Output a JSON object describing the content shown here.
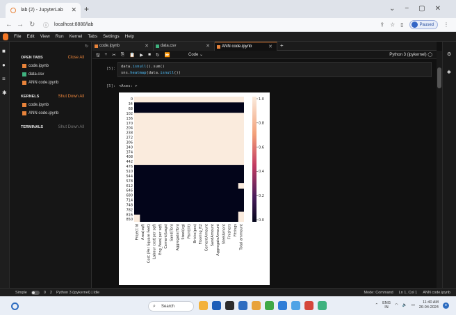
{
  "browser": {
    "tab_title": "lab (2) - JupyterLab",
    "url": "localhost:8888/lab",
    "profile": "Paused"
  },
  "menubar": [
    "File",
    "Edit",
    "View",
    "Run",
    "Kernel",
    "Tabs",
    "Settings",
    "Help"
  ],
  "sidebar": {
    "open_tabs_title": "OPEN TABS",
    "close_all": "Close All",
    "open_tabs": [
      "code.ipynb",
      "data.csv",
      "ANN code.ipynb"
    ],
    "kernels_title": "KERNELS",
    "shut_down_all": "Shut Down All",
    "kernels": [
      "code.ipynb",
      "ANN code.ipynb"
    ],
    "terminals_title": "TERMINALS",
    "terminals_shut_down": "Shut Down All"
  },
  "doc_tabs": [
    "code.ipynb",
    "data.csv",
    "ANN code.ipynb"
  ],
  "toolbar": {
    "cell_type": "Code",
    "kernel": "Python 3 (ipykernel)"
  },
  "cell": {
    "in_prompt": "[5]:",
    "line1_a": "data.",
    "line1_b": "isnull",
    "line1_c": "().sum()",
    "line2_a": "sns.",
    "line2_b": "heatmap",
    "line2_c": "(data.",
    "line2_d": "isnull",
    "line2_e": "())",
    "out_prompt": "[5]:",
    "out_text": "<Axes: >"
  },
  "chart_data": {
    "type": "heatmap",
    "title": "",
    "y_ticks": [
      "0",
      "34",
      "68",
      "102",
      "136",
      "170",
      "204",
      "238",
      "272",
      "306",
      "340",
      "374",
      "408",
      "442",
      "476",
      "510",
      "544",
      "578",
      "612",
      "646",
      "680",
      "714",
      "748",
      "782",
      "816",
      "850"
    ],
    "x_ticks": [
      "Project Id",
      "Area(sqf)",
      "Cost (Per Square Feet)",
      "Labour cost(per sqf)",
      "Eng_Fees(per sqf)",
      "Cement(bags)",
      "Sand(Ton)",
      "Aggregate(Ton)",
      "Steel(kg)",
      "Paint(lit)",
      "Bricks(pcs)",
      "Flooring_ft2",
      "CementAmount",
      "SandAmount",
      "AggregateAmount",
      "SteelAmont",
      "Finishers",
      "Fittings",
      "Total ammount"
    ],
    "colorbar_ticks": [
      "1.0",
      "0.8",
      "0.6",
      "0.4",
      "0.2",
      "0.0"
    ],
    "row_count": 870,
    "missing_row_ranges": [
      [
        0,
        40
      ],
      [
        112,
        474
      ]
    ],
    "extra_missing": [
      {
        "column": "Total ammount",
        "rows": [
          600,
          640
        ]
      },
      {
        "column": "Total ammount",
        "rows": [
          800,
          870
        ]
      },
      {
        "column": "Project Id",
        "rows": [
          820,
          870
        ]
      }
    ],
    "colors": {
      "low": "#03051a",
      "high": "#faebdd"
    }
  },
  "statusbar": {
    "mode": "Simple",
    "counts_a": "0",
    "counts_b": "2",
    "kernel_status": "Python 3 (ipykernel) | Idle",
    "command": "Mode: Command",
    "position": "Ln 1, Col 1",
    "file": "ANN code.ipynb"
  },
  "taskbar": {
    "search": "Search",
    "lang": "ENG",
    "region": "IN",
    "time": "11:40 AM",
    "date": "26-04-2024"
  }
}
